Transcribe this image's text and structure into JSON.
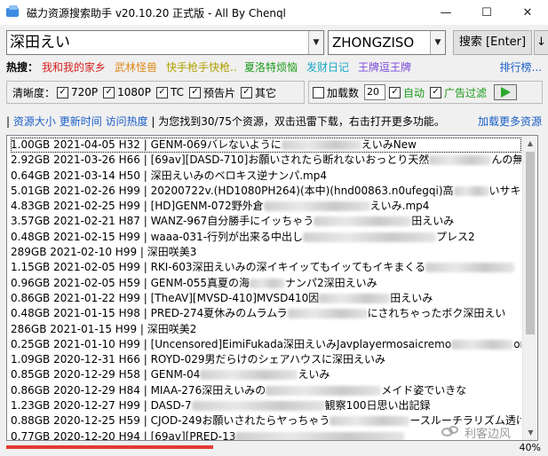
{
  "window": {
    "title": "磁力资源搜索助手 v20.10.20 正式版 - All By Chenql",
    "controls": [
      "—",
      "☐",
      "✕"
    ]
  },
  "search": {
    "value": "深田えい",
    "dropdown_glyph": "▼"
  },
  "source": {
    "value": "ZHONGZISO",
    "dropdown_glyph": "▼"
  },
  "search_button": "搜索 [Enter]",
  "sort_button": "↓",
  "hot": {
    "label": "热搜：",
    "tags": [
      {
        "text": "我和我的家乡",
        "color": "#d81e1e"
      },
      {
        "text": "武林怪兽",
        "color": "#e0891a"
      },
      {
        "text": "快手枪手快枪..",
        "color": "#b0a000"
      },
      {
        "text": "夏洛特烦恼",
        "color": "#1a9a1a"
      },
      {
        "text": "发财日记",
        "color": "#1aa7c7"
      },
      {
        "text": "王牌逗王牌",
        "color": "#7a4ad8"
      }
    ],
    "more": "排行榜..."
  },
  "filters": {
    "label": "清晰度：",
    "items": [
      {
        "label": "720P",
        "checked": true
      },
      {
        "label": "1080P",
        "checked": true
      },
      {
        "label": "TC",
        "checked": true
      },
      {
        "label": "预告片",
        "checked": true
      },
      {
        "label": "其它",
        "checked": true
      }
    ]
  },
  "options": {
    "load_label": "加载数",
    "load_checked": false,
    "load_count": "20",
    "auto_label": "自动",
    "auto_checked": true,
    "adfilter_label": "广告过滤",
    "adfilter_checked": true
  },
  "status": {
    "sep": "|",
    "size_link": "资源大小",
    "time_link": "更新时间",
    "heat_link": "访问热度",
    "message": "| 为您找到30/75个资源，双击迅雷下载，右击打开更多功能。",
    "more_link": "加载更多资源"
  },
  "results": [
    {
      "pre": "1.00GB 2021-04-05 H32 | GENM-069バレないように",
      "redact": 90,
      "post": "えいみNew",
      "selected": true
    },
    {
      "pre": "2.92GB 2021-03-26 H66 | [69av][DASD-710]お願いされたら断れないおっとり天然",
      "redact": 70,
      "post": "んの無自"
    },
    {
      "pre": "0.64GB 2021-03-14 H50 | 深田えいみのベロキス逆ナンパ.mp4",
      "redact": 0,
      "post": ""
    },
    {
      "pre": "5.01GB 2021-02-26 H99 | 20200722v.(HD1080PH264)(本中)(hnd00863.n0ufegqi)高",
      "redact": 40,
      "post": "いサキ"
    },
    {
      "pre": "4.83GB 2021-02-25 H99 | [HD]GENM-072野外倉",
      "redact": 120,
      "post": "えいみ.mp4"
    },
    {
      "pre": "3.57GB 2021-02-21 H87 | WANZ-967自分勝手にイッちゃう",
      "redact": 110,
      "post": "田えいみ"
    },
    {
      "pre": "0.48GB 2021-02-15 H99 | waaa-031-行列が出来る中出し",
      "redact": 150,
      "post": "プレス2"
    },
    {
      "pre": "289GB 2021-02-10 H99 | 深田咲美3",
      "redact": 0,
      "post": ""
    },
    {
      "pre": "1.15GB 2021-02-05 H99 | RKI-603深田えいみの深イキイッてもイッてもイキまくる",
      "redact": 100,
      "post": ""
    },
    {
      "pre": "0.96GB 2021-02-05 H59 | GENM-055真夏の海",
      "redact": 40,
      "post": "ナンパ2深田えいみ"
    },
    {
      "pre": "0.86GB 2021-01-22 H99 | [TheAV][MVSD-410]MVSD410因",
      "redact": 80,
      "post": "田えいみ"
    },
    {
      "pre": "0.48GB 2021-01-15 H98 | PRED-274夏休みのムラムラ",
      "redact": 90,
      "post": "にされちゃったボク深田えい"
    },
    {
      "pre": "286GB 2021-01-15 H99 | 深田咲美2",
      "redact": 0,
      "post": ""
    },
    {
      "pre": "0.25GB 2021-01-10 H99 | [Uncensored]EimiFukada深田えいみJavplayermosaicremo",
      "redact": 70,
      "post": "ongpr"
    },
    {
      "pre": "1.09GB 2020-12-31 H66 | ROYD-029男だらけのシェアハウスに深田えいみ",
      "redact": 0,
      "post": ""
    },
    {
      "pre": "0.85GB 2020-12-29 H58 | GENM-04",
      "redact": 110,
      "post": "えいみ"
    },
    {
      "pre": "0.86GB 2020-12-29 H84 | MIAA-276深田えいみの",
      "redact": 130,
      "post": "メイド姿でいきな"
    },
    {
      "pre": "1.23GB 2020-12-27 H99 | DASD-7",
      "redact": 150,
      "post": "観察100日思い出記録"
    },
    {
      "pre": "0.88GB 2020-12-25 H59 | CJOD-249お願いされたらヤっちゃう",
      "redact": 90,
      "post": "ースルーチラリズム透けエステ"
    },
    {
      "pre": "0.77GB 2020-12-20 H94 | [69av][PRED-13",
      "redact": 190,
      "post": ""
    }
  ],
  "progress": {
    "value": 0.4,
    "label": "40%",
    "color": "#e53935"
  },
  "watermark": {
    "text": "利客边风"
  }
}
